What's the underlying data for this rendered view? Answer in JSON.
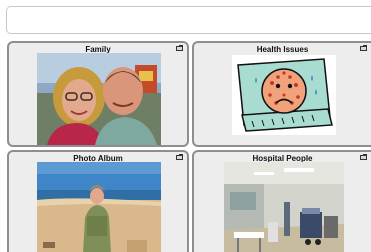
{
  "message_bar": {
    "text": ""
  },
  "tiles": [
    {
      "label": "Family",
      "image": "family-selfie-photo",
      "icon": "folder-icon"
    },
    {
      "label": "Health Issues",
      "image": "sick-face-in-bed-symbol",
      "icon": "folder-icon"
    },
    {
      "label": "Photo Album",
      "image": "beach-photo",
      "icon": "folder-icon"
    },
    {
      "label": "Hospital People",
      "image": "hospital-ward-photo",
      "icon": "folder-icon"
    }
  ],
  "colors": {
    "tile_background": "#ededed",
    "tile_border": "#8e8e8e",
    "label_text": "#111111"
  }
}
